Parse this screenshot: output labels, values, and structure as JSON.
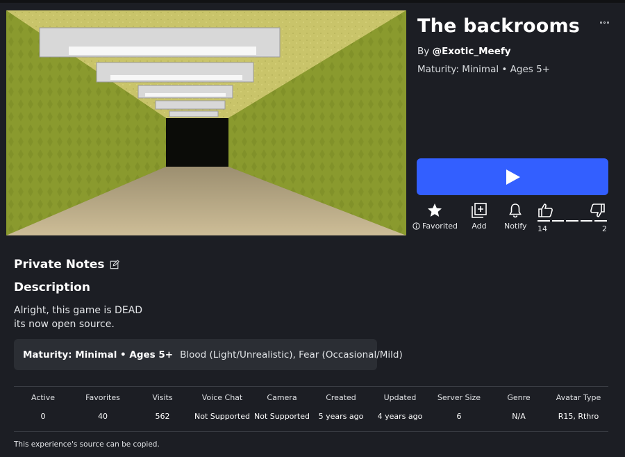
{
  "game": {
    "title": "The backrooms",
    "by_prefix": "By",
    "creator": "@Exotic_Meefy",
    "maturity_line": "Maturity: Minimal • Ages 5+"
  },
  "actions": {
    "favorite_label": "Favorited",
    "add_label": "Add",
    "notify_label": "Notify",
    "upvotes": "14",
    "downvotes": "2"
  },
  "private_notes": {
    "heading": "Private Notes"
  },
  "description": {
    "heading": "Description",
    "lines": [
      "Alright, this game is DEAD",
      "its now open source."
    ]
  },
  "maturity_box": {
    "label": "Maturity: Minimal • Ages 5+",
    "descriptors": "Blood (Light/Unrealistic), Fear (Occasional/Mild)"
  },
  "stats": [
    {
      "label": "Active",
      "value": "0"
    },
    {
      "label": "Favorites",
      "value": "40"
    },
    {
      "label": "Visits",
      "value": "562"
    },
    {
      "label": "Voice Chat",
      "value": "Not Supported"
    },
    {
      "label": "Camera",
      "value": "Not Supported"
    },
    {
      "label": "Created",
      "value": "5 years ago"
    },
    {
      "label": "Updated",
      "value": "4 years ago"
    },
    {
      "label": "Server Size",
      "value": "6"
    },
    {
      "label": "Genre",
      "value": "N/A"
    },
    {
      "label": "Avatar Type",
      "value": "R15, Rthro"
    }
  ],
  "footnote": "This experience's source can be copied.",
  "colors": {
    "background": "#1c1e24",
    "play_button": "#335fff",
    "panel": "#2b2e34"
  },
  "icons": [
    "more-icon",
    "play-icon",
    "star-icon",
    "info-icon",
    "add-icon",
    "bell-icon",
    "thumbs-up-icon",
    "thumbs-down-icon",
    "edit-icon"
  ]
}
